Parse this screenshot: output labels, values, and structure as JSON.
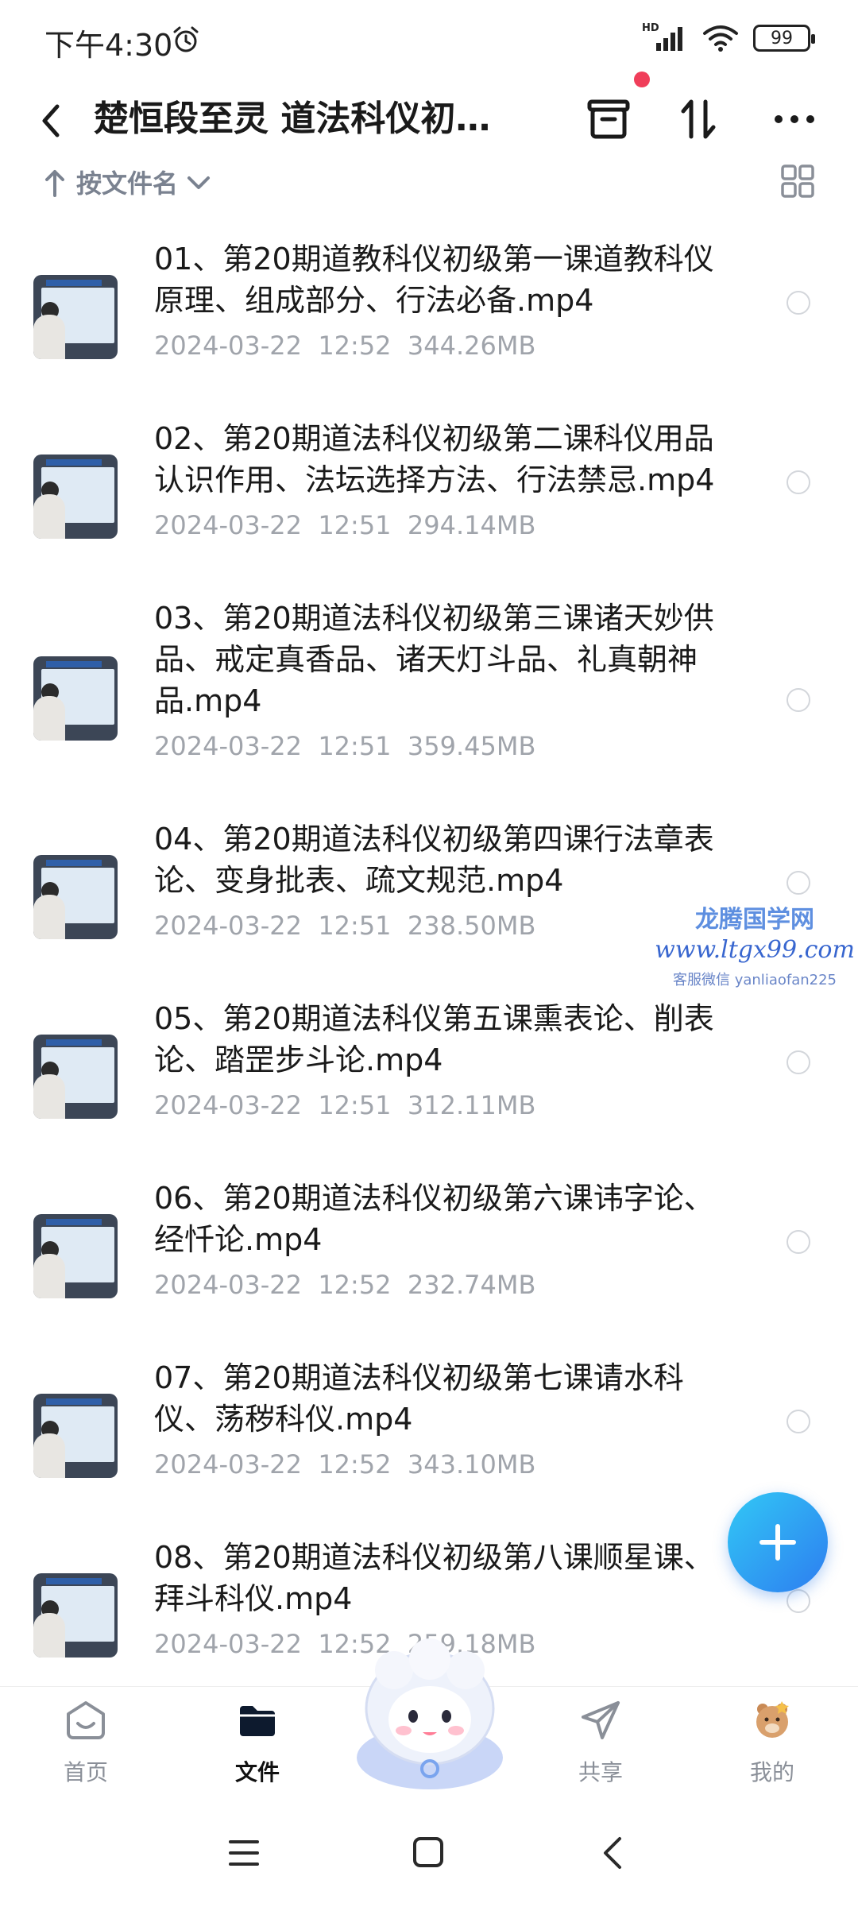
{
  "status_bar": {
    "time": "下午4:30",
    "network_label": "HD",
    "battery": "99"
  },
  "header": {
    "title": "楚恒段至灵 道法科仪初…"
  },
  "sort": {
    "label": "按文件名"
  },
  "files": [
    {
      "name": "01、第20期道教科仪初级第一课道教科仪原理、组成部分、行法必备.mp4",
      "date": "2024-03-22",
      "time": "12:52",
      "size": "344.26MB"
    },
    {
      "name": "02、第20期道法科仪初级第二课科仪用品认识作用、法坛选择方法、行法禁忌.mp4",
      "date": "2024-03-22",
      "time": "12:51",
      "size": "294.14MB"
    },
    {
      "name": "03、第20期道法科仪初级第三课诸天妙供品、戒定真香品、诸天灯斗品、礼真朝神品.mp4",
      "date": "2024-03-22",
      "time": "12:51",
      "size": "359.45MB"
    },
    {
      "name": "04、第20期道法科仪初级第四课行法章表论、变身批表、疏文规范.mp4",
      "date": "2024-03-22",
      "time": "12:51",
      "size": "238.50MB"
    },
    {
      "name": "05、第20期道法科仪第五课熏表论、削表论、踏罡步斗论.mp4",
      "date": "2024-03-22",
      "time": "12:51",
      "size": "312.11MB"
    },
    {
      "name": "06、第20期道法科仪初级第六课讳字论、经忏论.mp4",
      "date": "2024-03-22",
      "time": "12:52",
      "size": "232.74MB"
    },
    {
      "name": "07、第20期道法科仪初级第七课请水科仪、荡秽科仪.mp4",
      "date": "2024-03-22",
      "time": "12:52",
      "size": "343.10MB"
    },
    {
      "name": "08、第20期道法科仪初级第八课顺星课、拜斗科仪.mp4",
      "date": "2024-03-22",
      "time": "12:52",
      "size": "259.18MB"
    }
  ],
  "watermark": {
    "line1": "龙腾国学网",
    "line2": "www.ltgx99.com",
    "line3": "客服微信 yanliaofan225"
  },
  "bottom_nav": {
    "home": "首页",
    "files": "文件",
    "share": "共享",
    "mine": "我的"
  },
  "colors": {
    "accent": "#2d7df0",
    "badge": "#f03e5a",
    "secondary_text": "#a0a4ab"
  }
}
